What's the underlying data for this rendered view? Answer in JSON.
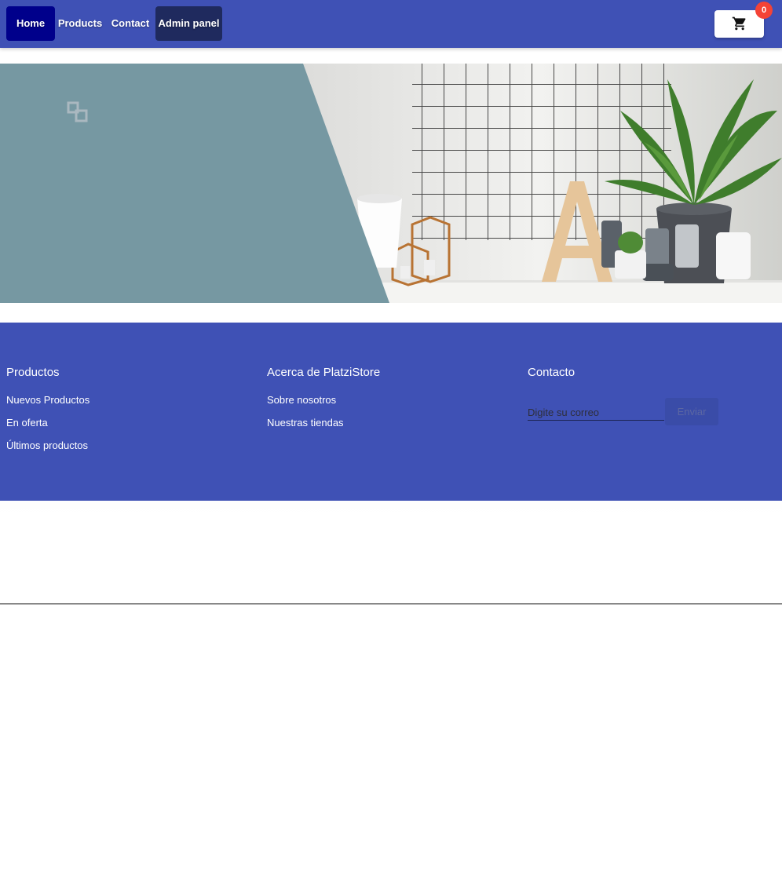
{
  "nav": {
    "home": "Home",
    "products": "Products",
    "contact": "Contact",
    "admin": "Admin panel"
  },
  "cart": {
    "icon": "shopping-cart-icon",
    "count": "0"
  },
  "banner": {
    "logo_icon": "linked-squares-icon",
    "image": "decor shelf photo"
  },
  "footer": {
    "productos": {
      "title": "Productos",
      "links": [
        "Nuevos Productos",
        "En oferta",
        "Últimos productos"
      ]
    },
    "about": {
      "title": "Acerca de PlatziStore",
      "links": [
        "Sobre nosotros",
        "Nuestras tiendas"
      ]
    },
    "contact": {
      "title": "Contacto",
      "email_placeholder": "Digite su correo",
      "send_label": "Enviar"
    }
  },
  "colors": {
    "primary": "#3f51b5",
    "home_active": "#00008b",
    "admin": "#1f2a5e",
    "badge": "#f44336",
    "banner_panel": "#7698a2"
  }
}
